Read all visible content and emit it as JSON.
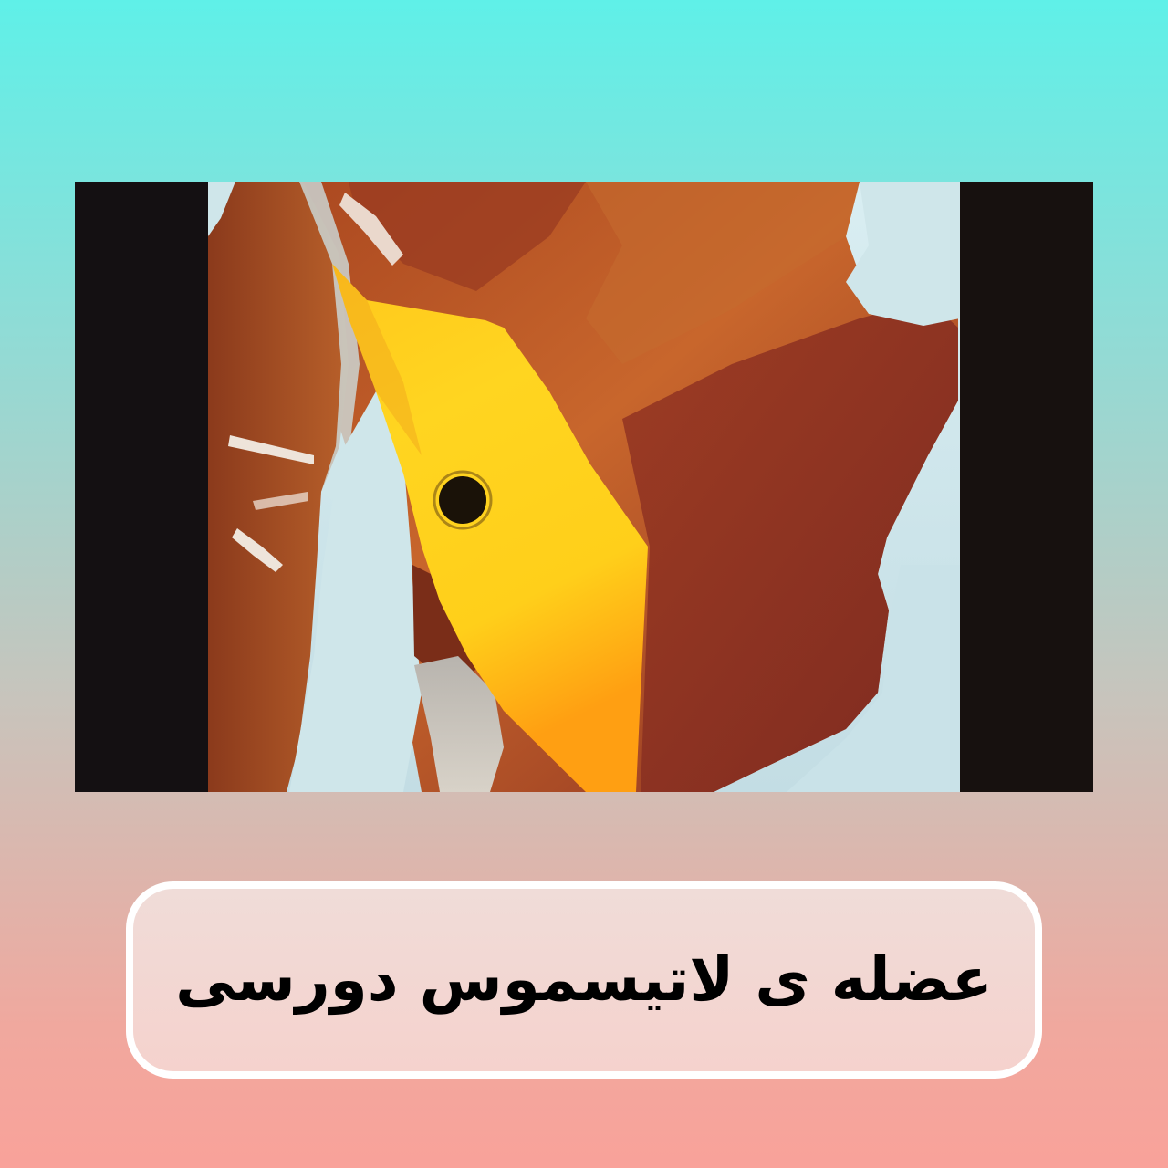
{
  "figure": {
    "icon": "latissimus-dorsi-anatomy-illustration",
    "colors": {
      "frame": "#141012",
      "background": "#cfe6ea",
      "muscle_dark": "#8a2f22",
      "muscle_mid": "#b5552a",
      "muscle_light": "#d8772e",
      "highlight": "#ffd21a",
      "marker_dot": "#1a1208"
    }
  },
  "caption": {
    "text": "عضله ی لاتیسموس دورسی"
  },
  "colors": {
    "gradient_top": "#5ff0e8",
    "gradient_bottom": "#f9a29a",
    "caption_border": "#ffffff",
    "caption_fill": "#f2d6d2",
    "caption_text": "#000000"
  }
}
